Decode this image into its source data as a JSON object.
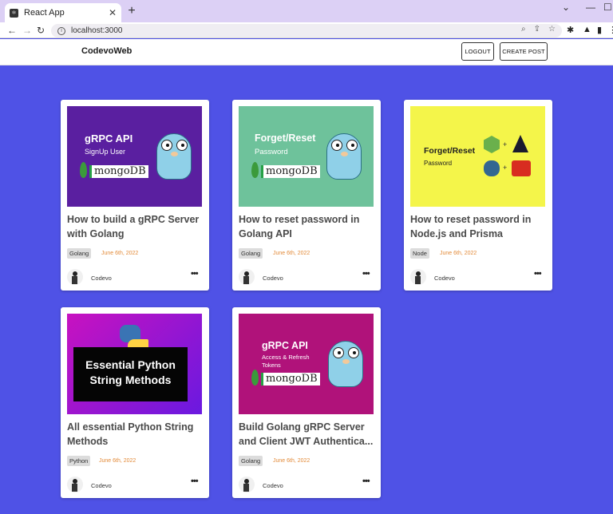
{
  "browser": {
    "tab_title": "React App",
    "url": "localhost:3000"
  },
  "app": {
    "brand": "CodevoWeb",
    "logout_label": "LOGOUT",
    "create_label": "CREATE POST"
  },
  "posts": [
    {
      "title": "How to build a gRPC Server with Golang",
      "tag": "Golang",
      "date": "June 6th, 2022",
      "author": "Codevo",
      "thumb": {
        "bg": "#5a1fa0",
        "line1": "gRPC API",
        "line2": "SignUp User",
        "logo": "mongoDB"
      }
    },
    {
      "title": "How to reset password in Golang API",
      "tag": "Golang",
      "date": "June 6th, 2022",
      "author": "Codevo",
      "thumb": {
        "bg": "#6ec29b",
        "line1": "Forget/Reset",
        "line2": "Password",
        "logo": "mongoDB"
      }
    },
    {
      "title": "How to reset password in Node.js and Prisma",
      "tag": "Node",
      "date": "June 6th, 2022",
      "author": "Codevo",
      "thumb": {
        "bg": "#f4f54a",
        "line1": "Forget/Reset",
        "line2": "Password"
      }
    },
    {
      "title": "All essential Python String Methods",
      "tag": "Python",
      "date": "June 6th, 2022",
      "author": "Codevo",
      "thumb": {
        "bg": "#b010b8",
        "line1": "Essential Python",
        "line2": "String Methods"
      }
    },
    {
      "title": "Build Golang gRPC Server and Client JWT Authentica...",
      "tag": "Golang",
      "date": "June 6th, 2022",
      "author": "Codevo",
      "thumb": {
        "bg": "#b0127a",
        "line1": "gRPC API",
        "line2": "Access & Refresh",
        "line3": "Tokens",
        "logo": "mongoDB"
      }
    }
  ],
  "colors": {
    "page_bg": "#4f52e6",
    "date": "#e38b3a",
    "tab_strip": "#dcd0f5"
  }
}
